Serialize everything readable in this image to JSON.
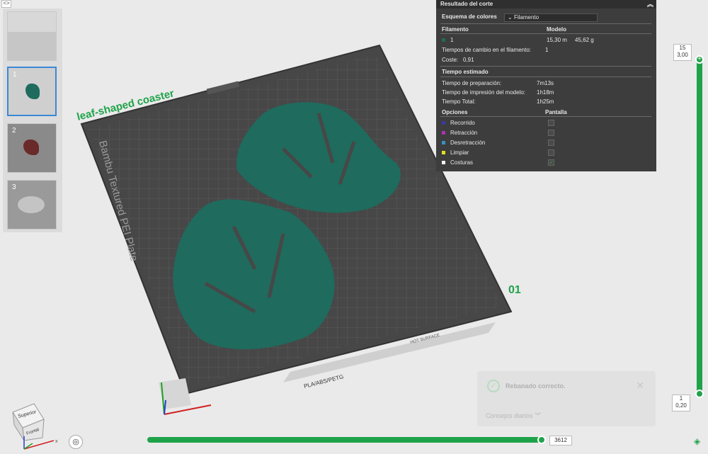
{
  "window": {
    "topleft_glyph": "<>"
  },
  "plates": [
    {
      "num": ""
    },
    {
      "num": "1"
    },
    {
      "num": "2"
    },
    {
      "num": "3"
    }
  ],
  "canvas": {
    "model_label": "leaf-shaped coaster",
    "plate_name": "Bambu Textured PEI Plate",
    "plate_number": "01",
    "material_text": "PLA/ABS/PETG",
    "hot_surface": "HOT SURFACE",
    "bed_color": "#4a4a4a",
    "model_color": "#1f6b5d",
    "label_color": "#1fa34a"
  },
  "panel": {
    "title": "Resultado del corte",
    "scheme_label": "Esquema de colores",
    "scheme_value": "Filamento",
    "col_filament": "Filamento",
    "col_model": "Modelo",
    "filament_id": "1",
    "filament_len": "15,30 m",
    "filament_weight": "45,62 g",
    "changes_label": "Tiempos de cambio en el filamento:",
    "changes_value": "1",
    "cost_label": "Coste:",
    "cost_value": "0,91",
    "time_heading": "Tiempo estimado",
    "prep_label": "Tiempo de preparación:",
    "prep_value": "7m13s",
    "print_label": "Tiempo de impresión del modelo:",
    "print_value": "1h18m",
    "total_label": "Tiempo Total:",
    "total_value": "1h25m",
    "options_heading": "Opciones",
    "display_heading": "Pantalla",
    "options": [
      {
        "label": "Recorrido",
        "color": "#3a3aa0",
        "checked": false
      },
      {
        "label": "Retracción",
        "color": "#b030b0",
        "checked": false
      },
      {
        "label": "Desretracción",
        "color": "#3a90c0",
        "checked": false
      },
      {
        "label": "Limpiar",
        "color": "#e0e020",
        "checked": false
      },
      {
        "label": "Costuras",
        "color": "#f0f0f0",
        "checked": true
      }
    ]
  },
  "vslider": {
    "top_layer": "15",
    "top_height": "3,00",
    "bottom_layer": "1",
    "bottom_height": "0,20"
  },
  "hslider": {
    "value": "3612"
  },
  "toast": {
    "message": "Rebanado correcto.",
    "tips": "Consejos diarios"
  },
  "viewcube": {
    "top": "Superior",
    "front": "Frontal"
  }
}
